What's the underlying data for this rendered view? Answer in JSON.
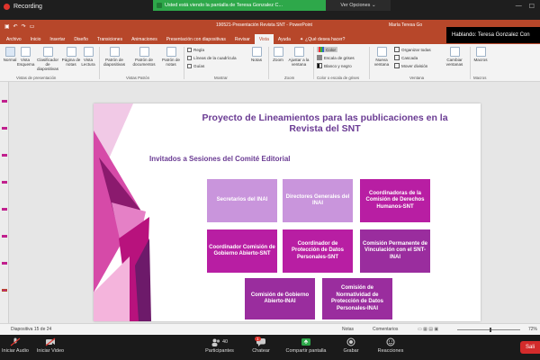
{
  "zoom": {
    "recording_label": "Recording",
    "share_banner": "Usted está viendo la pantalla de Teresa Gonzalez C...",
    "view_options": "Ver Opciones",
    "speaking": "Hablando: Teresa Gonzalez Con",
    "bottom": {
      "audio": "Iniciar Audio",
      "video": "Iniciar Video",
      "participants_count": "40",
      "participants": "Participantes",
      "chat": "Chatear",
      "chat_badge": "1",
      "share": "Compartir pantalla",
      "record": "Grabar",
      "reactions": "Reacciones",
      "end": "Sali"
    }
  },
  "powerpoint": {
    "file_title": "190521-Presentación Revista SNT - PowerPoint",
    "user": "María Teresa Go",
    "tabs": [
      "Archivo",
      "Inicio",
      "Insertar",
      "Diseño",
      "Transiciones",
      "Animaciones",
      "Presentación con diapositivas",
      "Revisar",
      "Vista",
      "Ayuda"
    ],
    "active_tab": "Vista",
    "tell_me": "¿Qué desea hacer?",
    "ribbon": {
      "normal": "Normal",
      "outline": "Vista Esquema",
      "sorter": "Clasificador de diapositivas",
      "notes_page": "Página de notas",
      "reading": "Vista Lectura",
      "slide_master": "Patrón de diapositivas",
      "handout_master": "Patrón de documentos",
      "notes_master": "Patrón de notas",
      "ruler": "Regla",
      "gridlines": "Líneas de la cuadrícula",
      "guides": "Guías",
      "notes": "Notas",
      "zoom": "Zoom",
      "fit": "Ajustar a la ventana",
      "color": "Color",
      "grayscale": "Escala de grises",
      "bw": "Blanco y negro",
      "new_window": "Nueva ventana",
      "arrange": "Organizar todas",
      "cascade": "Cascada",
      "move_split": "Mover división",
      "switch": "Cambiar ventanas",
      "macros": "Macros",
      "group_views": "Vistas de presentación",
      "group_master": "Vistas Patrón",
      "group_show": "Mostrar",
      "group_zoom": "Zoom",
      "group_color": "Color o escala de grises",
      "group_window": "Ventana",
      "group_macros": "Macros"
    },
    "status": {
      "slide": "Diapositiva 15 de 24",
      "notes": "Notas",
      "comments": "Comentarios",
      "zoom": "72%"
    }
  },
  "slide": {
    "title": "Proyecto de Lineamientos para las publicaciones en la Revista del SNT",
    "subtitle": "Invitados a Sesiones del Comité Editorial",
    "boxes": [
      "Secretarios del INAI",
      "Directores Generales del INAI",
      "Coordinadoras de la Comisión de Derechos Humanos-SNT",
      "Coordinador Comisión de Gobierno Abierto-SNT",
      "Coordinador de Protección de Datos Personales-SNT",
      "Comisión Permanente de Vinculación con el SNT-INAI",
      "Comisión de Gobierno Abierto-INAI",
      "Comisión de Normatividad de Protección de Datos Personales-INAI"
    ]
  },
  "colors": {
    "ppt_accent": "#b7472a",
    "title_purple": "#6a3b93",
    "box_light": "#c995dc",
    "box_magenta": "#b81ea3",
    "box_purple": "#9a2d9e",
    "zoom_green": "#2ea84a"
  }
}
